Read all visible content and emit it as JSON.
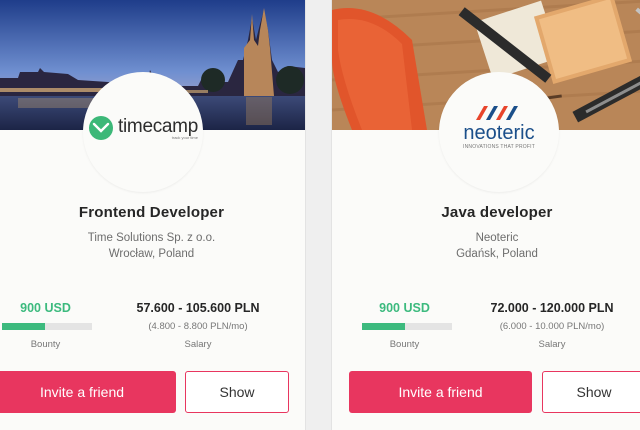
{
  "cards": [
    {
      "logo_text": "timecamp",
      "logo_tagline": "track your time",
      "title": "Frontend Developer",
      "company": "Time Solutions Sp. z o.o.",
      "location": "Wrocław, Poland",
      "bounty": "900 USD",
      "bounty_progress": 0.48,
      "bounty_label": "Bounty",
      "salary": "57.600 - 105.600 PLN",
      "salary_sub": "(4.800 - 8.800 PLN/mo)",
      "salary_label": "Salary",
      "invite_label": "Invite a friend",
      "show_label": "Show"
    },
    {
      "logo_text": "neoteric",
      "logo_tagline": "INNOVATIONS THAT PROFIT",
      "title": "Java developer",
      "company": "Neoteric",
      "location": "Gdańsk, Poland",
      "bounty": "900 USD",
      "bounty_progress": 0.48,
      "bounty_label": "Bounty",
      "salary": "72.000 - 120.000 PLN",
      "salary_sub": "(6.000 - 10.000 PLN/mo)",
      "salary_label": "Salary",
      "invite_label": "Invite a friend",
      "show_label": "Show"
    }
  ],
  "colors": {
    "accent": "#e8365f",
    "bounty_green": "#3cba7e",
    "timecamp_green": "#3cb878",
    "neoteric_blue": "#1b4f8a",
    "neoteric_red": "#e8452c"
  }
}
